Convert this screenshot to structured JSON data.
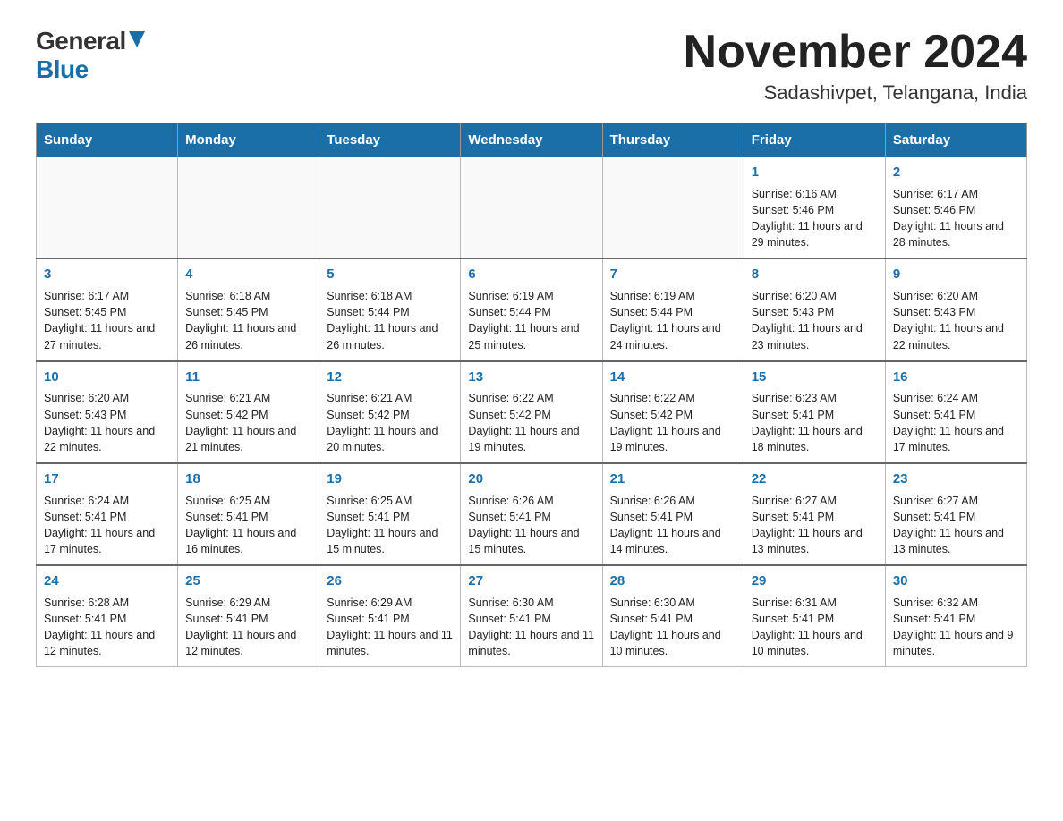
{
  "logo": {
    "general": "General",
    "blue": "Blue"
  },
  "title": "November 2024",
  "subtitle": "Sadashivpet, Telangana, India",
  "days_of_week": [
    "Sunday",
    "Monday",
    "Tuesday",
    "Wednesday",
    "Thursday",
    "Friday",
    "Saturday"
  ],
  "weeks": [
    [
      {
        "day": "",
        "info": ""
      },
      {
        "day": "",
        "info": ""
      },
      {
        "day": "",
        "info": ""
      },
      {
        "day": "",
        "info": ""
      },
      {
        "day": "",
        "info": ""
      },
      {
        "day": "1",
        "info": "Sunrise: 6:16 AM\nSunset: 5:46 PM\nDaylight: 11 hours and 29 minutes."
      },
      {
        "day": "2",
        "info": "Sunrise: 6:17 AM\nSunset: 5:46 PM\nDaylight: 11 hours and 28 minutes."
      }
    ],
    [
      {
        "day": "3",
        "info": "Sunrise: 6:17 AM\nSunset: 5:45 PM\nDaylight: 11 hours and 27 minutes."
      },
      {
        "day": "4",
        "info": "Sunrise: 6:18 AM\nSunset: 5:45 PM\nDaylight: 11 hours and 26 minutes."
      },
      {
        "day": "5",
        "info": "Sunrise: 6:18 AM\nSunset: 5:44 PM\nDaylight: 11 hours and 26 minutes."
      },
      {
        "day": "6",
        "info": "Sunrise: 6:19 AM\nSunset: 5:44 PM\nDaylight: 11 hours and 25 minutes."
      },
      {
        "day": "7",
        "info": "Sunrise: 6:19 AM\nSunset: 5:44 PM\nDaylight: 11 hours and 24 minutes."
      },
      {
        "day": "8",
        "info": "Sunrise: 6:20 AM\nSunset: 5:43 PM\nDaylight: 11 hours and 23 minutes."
      },
      {
        "day": "9",
        "info": "Sunrise: 6:20 AM\nSunset: 5:43 PM\nDaylight: 11 hours and 22 minutes."
      }
    ],
    [
      {
        "day": "10",
        "info": "Sunrise: 6:20 AM\nSunset: 5:43 PM\nDaylight: 11 hours and 22 minutes."
      },
      {
        "day": "11",
        "info": "Sunrise: 6:21 AM\nSunset: 5:42 PM\nDaylight: 11 hours and 21 minutes."
      },
      {
        "day": "12",
        "info": "Sunrise: 6:21 AM\nSunset: 5:42 PM\nDaylight: 11 hours and 20 minutes."
      },
      {
        "day": "13",
        "info": "Sunrise: 6:22 AM\nSunset: 5:42 PM\nDaylight: 11 hours and 19 minutes."
      },
      {
        "day": "14",
        "info": "Sunrise: 6:22 AM\nSunset: 5:42 PM\nDaylight: 11 hours and 19 minutes."
      },
      {
        "day": "15",
        "info": "Sunrise: 6:23 AM\nSunset: 5:41 PM\nDaylight: 11 hours and 18 minutes."
      },
      {
        "day": "16",
        "info": "Sunrise: 6:24 AM\nSunset: 5:41 PM\nDaylight: 11 hours and 17 minutes."
      }
    ],
    [
      {
        "day": "17",
        "info": "Sunrise: 6:24 AM\nSunset: 5:41 PM\nDaylight: 11 hours and 17 minutes."
      },
      {
        "day": "18",
        "info": "Sunrise: 6:25 AM\nSunset: 5:41 PM\nDaylight: 11 hours and 16 minutes."
      },
      {
        "day": "19",
        "info": "Sunrise: 6:25 AM\nSunset: 5:41 PM\nDaylight: 11 hours and 15 minutes."
      },
      {
        "day": "20",
        "info": "Sunrise: 6:26 AM\nSunset: 5:41 PM\nDaylight: 11 hours and 15 minutes."
      },
      {
        "day": "21",
        "info": "Sunrise: 6:26 AM\nSunset: 5:41 PM\nDaylight: 11 hours and 14 minutes."
      },
      {
        "day": "22",
        "info": "Sunrise: 6:27 AM\nSunset: 5:41 PM\nDaylight: 11 hours and 13 minutes."
      },
      {
        "day": "23",
        "info": "Sunrise: 6:27 AM\nSunset: 5:41 PM\nDaylight: 11 hours and 13 minutes."
      }
    ],
    [
      {
        "day": "24",
        "info": "Sunrise: 6:28 AM\nSunset: 5:41 PM\nDaylight: 11 hours and 12 minutes."
      },
      {
        "day": "25",
        "info": "Sunrise: 6:29 AM\nSunset: 5:41 PM\nDaylight: 11 hours and 12 minutes."
      },
      {
        "day": "26",
        "info": "Sunrise: 6:29 AM\nSunset: 5:41 PM\nDaylight: 11 hours and 11 minutes."
      },
      {
        "day": "27",
        "info": "Sunrise: 6:30 AM\nSunset: 5:41 PM\nDaylight: 11 hours and 11 minutes."
      },
      {
        "day": "28",
        "info": "Sunrise: 6:30 AM\nSunset: 5:41 PM\nDaylight: 11 hours and 10 minutes."
      },
      {
        "day": "29",
        "info": "Sunrise: 6:31 AM\nSunset: 5:41 PM\nDaylight: 11 hours and 10 minutes."
      },
      {
        "day": "30",
        "info": "Sunrise: 6:32 AM\nSunset: 5:41 PM\nDaylight: 11 hours and 9 minutes."
      }
    ]
  ]
}
